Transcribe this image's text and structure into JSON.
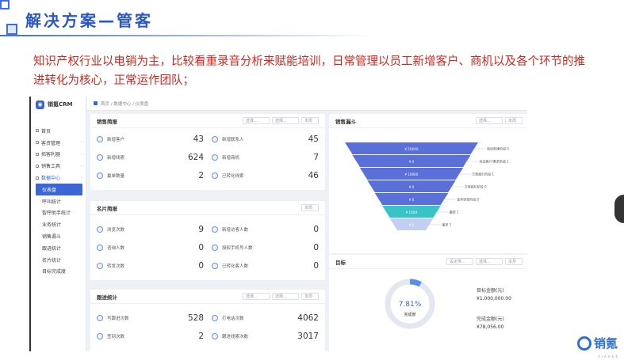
{
  "slide": {
    "title": "解决方案—管客",
    "description": "知识产权行业以电销为主，比较看重录音分析来赋能培训，日常管理以员工新增客户、商机以及各个环节的推进转化为核心，正常运作团队；"
  },
  "app": {
    "brand": "销氪CRM",
    "breadcrumb": "首页 / 数据中心 / 仪表盘",
    "menu": [
      {
        "label": "首页",
        "type": "top"
      },
      {
        "label": "客资管理",
        "type": "top",
        "caret": true
      },
      {
        "label": "拓客利器",
        "type": "top",
        "caret": true
      },
      {
        "label": "销售工具",
        "type": "top",
        "caret": true
      },
      {
        "label": "数据中心",
        "type": "open",
        "caret": true
      },
      {
        "label": "仪表盘",
        "type": "active"
      },
      {
        "label": "呼叫统计",
        "type": "sub"
      },
      {
        "label": "智呼助手统计",
        "type": "sub"
      },
      {
        "label": "业务统计",
        "type": "sub"
      },
      {
        "label": "销售漏斗",
        "type": "sub"
      },
      {
        "label": "跟进统计",
        "type": "sub"
      },
      {
        "label": "名片统计",
        "type": "sub"
      },
      {
        "label": "目标完成度",
        "type": "sub"
      }
    ]
  },
  "sales_brief": {
    "title": "销售简报",
    "filter1": "选择...",
    "filter2": "选择...",
    "period": "本周",
    "stats": [
      {
        "label": "新增客户",
        "value": "43"
      },
      {
        "label": "新增联系人",
        "value": "45"
      },
      {
        "label": "新增线索",
        "value": "624"
      },
      {
        "label": "新增商机",
        "value": "7"
      },
      {
        "label": "赢单数量",
        "value": "2"
      },
      {
        "label": "已转化线索",
        "value": "46"
      }
    ]
  },
  "card_brief": {
    "title": "名片简报",
    "period": "本周",
    "stats": [
      {
        "label": "浏览次数",
        "value": "9"
      },
      {
        "label": "新增访客人数",
        "value": "0"
      },
      {
        "label": "咨询人数",
        "value": "0"
      },
      {
        "label": "授权手机号人数",
        "value": "0"
      },
      {
        "label": "转发次数",
        "value": "0"
      },
      {
        "label": "已转化客人数",
        "value": "0"
      }
    ]
  },
  "followup": {
    "title": "跟进统计",
    "filter1": "选择...",
    "filter2": "选择...",
    "period": "本周",
    "stats": [
      {
        "label": "写跟进次数",
        "value": "528"
      },
      {
        "label": "打电话次数",
        "value": "4062"
      },
      {
        "label": "签到次数",
        "value": "2"
      },
      {
        "label": "跟进线索次数",
        "value": "3017"
      }
    ]
  },
  "funnel": {
    "title": "销售漏斗",
    "filter": "选择...",
    "period": "本周",
    "stage_labels": [
      "¥ 2XXXX",
      "¥ X",
      "¥ 109XX",
      "¥ X",
      "¥ X",
      "¥ 1XXX",
      "¥ X"
    ],
    "annotations": [
      "商机新建阶段 0",
      "验证客户/需求阶段 1",
      "方案报价阶段 1",
      "方案报价阶段 0",
      "谈判审核阶段 0",
      "赢单 1",
      "输单 1"
    ],
    "colors": [
      "#5b6fd9",
      "#5b6fd9",
      "#5b6fd9",
      "#5b6fd9",
      "#5b6fd9",
      "#38c4c7",
      "#c3cff2"
    ]
  },
  "goal": {
    "title": "目标",
    "filter1": "设定类...",
    "filter2": "选择...",
    "period": "本月",
    "percent": "7.81%",
    "percent_value": 7.81,
    "ring_label": "完成度",
    "target_label": "目标金额(元)",
    "target_value": "¥1,000,000.00",
    "done_label": "完成金额(元)",
    "done_value": "¥78,056.00"
  },
  "footer_brand": {
    "name": "销氪",
    "sub": "XIAOKE"
  },
  "colors": {
    "accent": "#3c66d6",
    "title": "#2b57c6",
    "desc": "#d4261f"
  }
}
